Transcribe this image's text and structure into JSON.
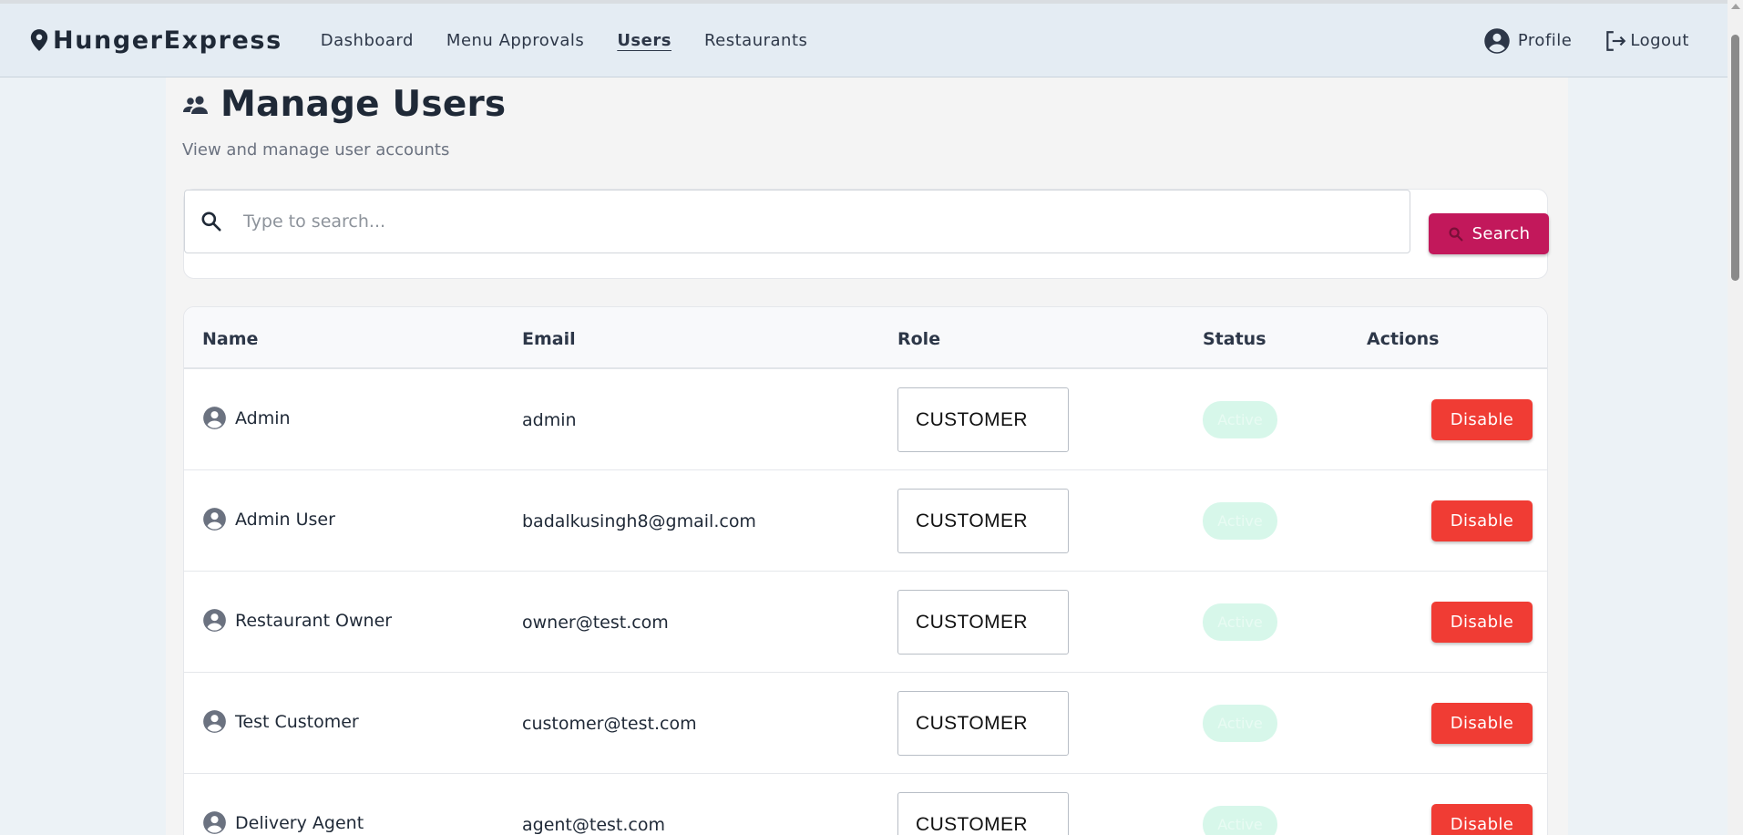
{
  "app": {
    "brand": "HungerExpress",
    "nav": [
      {
        "label": "Dashboard",
        "active": false
      },
      {
        "label": "Menu Approvals",
        "active": false
      },
      {
        "label": "Users",
        "active": true
      },
      {
        "label": "Restaurants",
        "active": false
      }
    ],
    "profile_label": "Profile",
    "logout_label": "Logout"
  },
  "page": {
    "title": "Manage Users",
    "subtitle": "View and manage user accounts"
  },
  "search": {
    "placeholder": "Type to search...",
    "value": "",
    "button_label": "Search"
  },
  "table": {
    "headers": {
      "name": "Name",
      "email": "Email",
      "role": "Role",
      "status": "Status",
      "actions": "Actions"
    },
    "rows": [
      {
        "name": "Admin",
        "email": "admin",
        "role": "CUSTOMER",
        "status": "Active",
        "action": "Disable"
      },
      {
        "name": "Admin User",
        "email": "badalkusingh8@gmail.com",
        "role": "CUSTOMER",
        "status": "Active",
        "action": "Disable"
      },
      {
        "name": "Restaurant Owner",
        "email": "owner@test.com",
        "role": "CUSTOMER",
        "status": "Active",
        "action": "Disable"
      },
      {
        "name": "Test Customer",
        "email": "customer@test.com",
        "role": "CUSTOMER",
        "status": "Active",
        "action": "Disable"
      },
      {
        "name": "Delivery Agent",
        "email": "agent@test.com",
        "role": "CUSTOMER",
        "status": "Active",
        "action": "Disable"
      }
    ]
  },
  "colors": {
    "primary": "#c2185b",
    "danger": "#f03c34",
    "status_active_bg": "#d7f7ea",
    "header_bg": "#e4ecf3"
  },
  "icons": {
    "brand": "location-pin-icon",
    "profile": "account-circle-icon",
    "logout": "logout-icon",
    "title": "people-icon",
    "search": "search-icon",
    "user": "account-circle-icon"
  }
}
